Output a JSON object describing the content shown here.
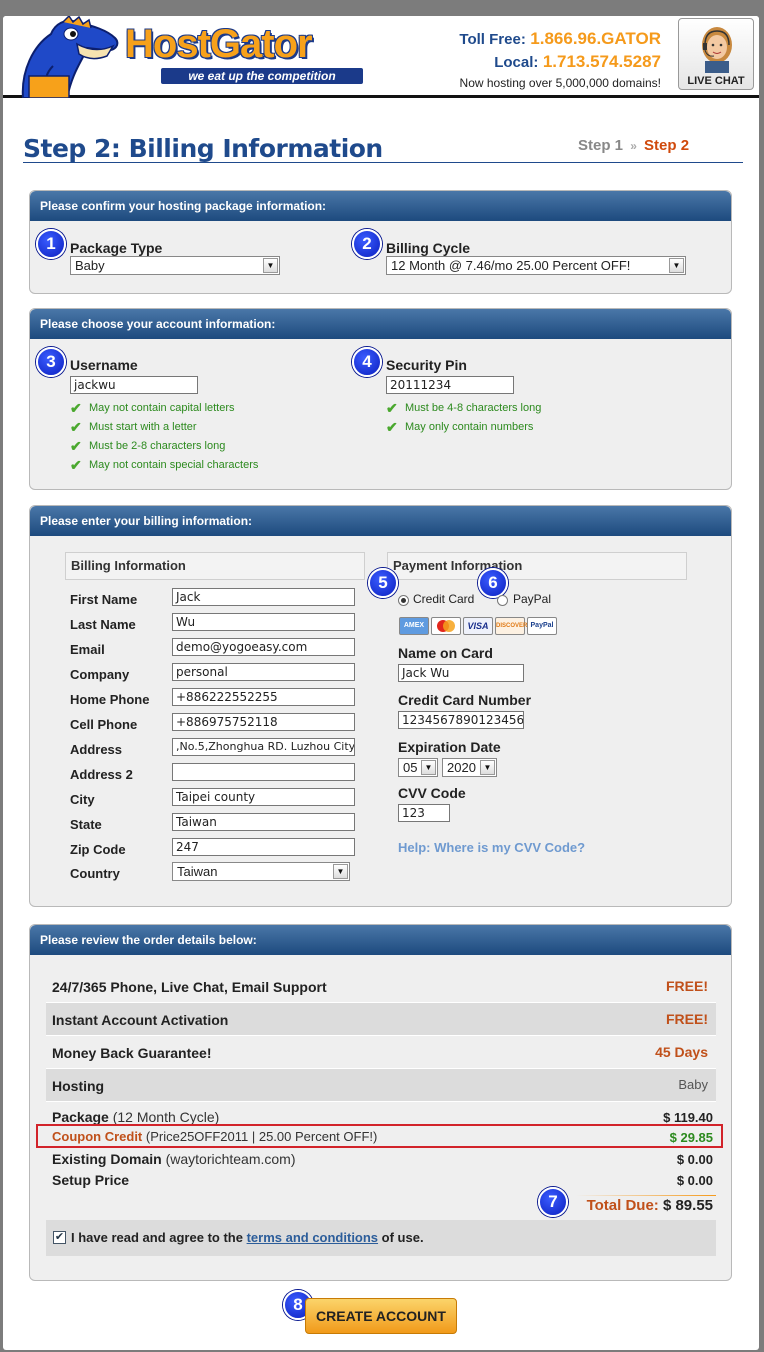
{
  "header": {
    "brand": "HostGator",
    "tagline": "we eat up the competition",
    "toll_free_label": "Toll Free:",
    "toll_free_number": "1.866.96.GATOR",
    "local_label": "Local:",
    "local_number": "1.713.574.5287",
    "hosting_note": "Now hosting over 5,000,000 domains!",
    "live_chat_label": "LIVE CHAT"
  },
  "page": {
    "title": "Step 2: Billing Information",
    "step1": "Step 1",
    "step_sep": "»",
    "step2": "Step 2"
  },
  "package_panel": {
    "heading": "Please confirm your hosting package information:",
    "badge1": "1",
    "package_label": "Package Type",
    "package_value": "Baby",
    "badge2": "2",
    "cycle_label": "Billing Cycle",
    "cycle_value": "12 Month @ 7.46/mo 25.00 Percent OFF!"
  },
  "account_panel": {
    "heading": "Please choose your account information:",
    "badge3": "3",
    "username_label": "Username",
    "username_value": "jackwu",
    "username_rules": [
      "May not contain capital letters",
      "Must start with a letter",
      "Must be 2-8 characters long",
      "May not contain special characters"
    ],
    "badge4": "4",
    "pin_label": "Security Pin",
    "pin_value": "20111234",
    "pin_rules": [
      "Must be 4-8 characters long",
      "May only contain numbers"
    ]
  },
  "billing_panel": {
    "heading": "Please enter your billing information:",
    "billing_subhead": "Billing Information",
    "fields": [
      {
        "label": "First Name",
        "value": "Jack"
      },
      {
        "label": "Last Name",
        "value": "Wu"
      },
      {
        "label": "Email",
        "value": "demo@yogoeasy.com"
      },
      {
        "label": "Company",
        "value": "personal"
      },
      {
        "label": "Home Phone",
        "value": "+886222552255"
      },
      {
        "label": "Cell Phone",
        "value": "+886975752118"
      },
      {
        "label": "Address",
        "value": ",No.5,Zhonghua RD. Luzhou City"
      },
      {
        "label": "Address 2",
        "value": ""
      },
      {
        "label": "City",
        "value": "Taipei county"
      },
      {
        "label": "State",
        "value": "Taiwan"
      },
      {
        "label": "Zip Code",
        "value": "247"
      },
      {
        "label": "Country",
        "value": "Taiwan"
      }
    ],
    "payment_subhead": "Payment Information",
    "badge5": "5",
    "badge6": "6",
    "credit_card_label": "Credit Card",
    "paypal_label": "PayPal",
    "cards": [
      "AMEX",
      "MC",
      "VISA",
      "DISCOVER",
      "PayPal"
    ],
    "name_on_card_label": "Name on Card",
    "name_on_card_value": "Jack Wu",
    "cc_number_label": "Credit Card Number",
    "cc_number_value": "1234567890123456",
    "expiration_label": "Expiration Date",
    "exp_month": "05",
    "exp_year": "2020",
    "cvv_label": "CVV Code",
    "cvv_value": "123",
    "cvv_help": "Help: Where is my CVV Code?"
  },
  "order_panel": {
    "heading": "Please review the order details below:",
    "rows": [
      {
        "label": "24/7/365 Phone, Live Chat, Email Support",
        "value": "FREE!"
      },
      {
        "label": "Instant Account Activation",
        "value": "FREE!"
      },
      {
        "label": "Money Back Guarantee!",
        "value": "45 Days"
      },
      {
        "label": "Hosting",
        "value": "Baby"
      }
    ],
    "package_label": "Package",
    "package_note": "(12 Month Cycle)",
    "package_amount": "$ 119.40",
    "coupon_label": "Coupon Credit",
    "coupon_note": "(Price25OFF2011 | 25.00 Percent OFF!)",
    "coupon_amount": "$ 29.85",
    "domain_label": "Existing Domain",
    "domain_note": "(waytorichteam.com)",
    "domain_amount": "$ 0.00",
    "setup_label": "Setup Price",
    "setup_amount": "$ 0.00",
    "badge7": "7",
    "total_label": "Total Due:",
    "total_amount": "$ 89.55",
    "agree_prefix": "I have read and agree to the",
    "agree_link": "terms and conditions",
    "agree_suffix": "of use."
  },
  "footer": {
    "badge8": "8",
    "create_button": "CREATE ACCOUNT"
  },
  "colors": {
    "panel_header": "#1d4a7e",
    "title_blue": "#1f4a8c",
    "accent_orange": "#f59a1b",
    "valid_green": "#2c8a1e",
    "badge_blue": "#0b1fbf"
  }
}
